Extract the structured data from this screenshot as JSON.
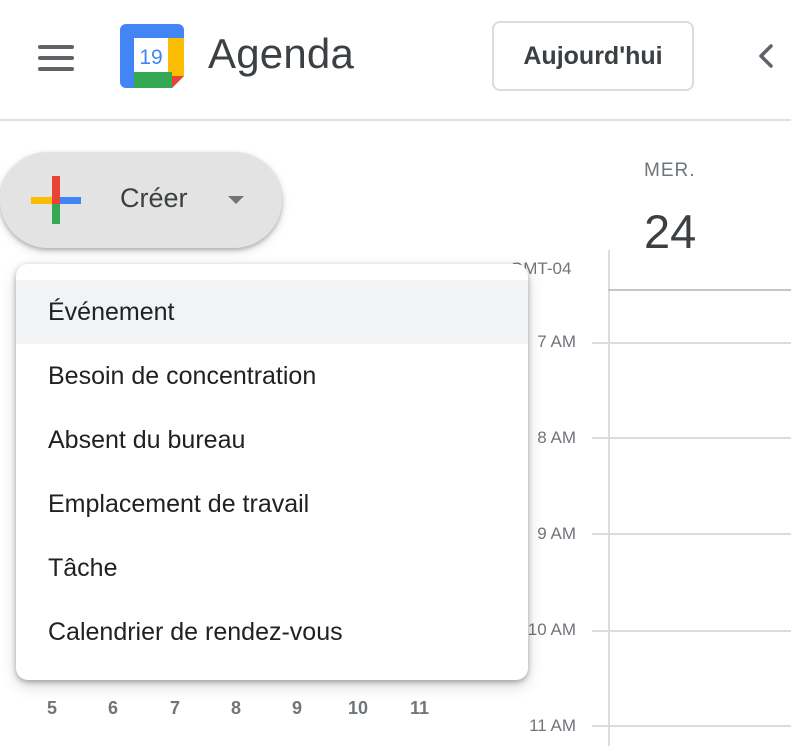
{
  "header": {
    "app_title": "Agenda",
    "logo_date": "19",
    "today_button": "Aujourd'hui",
    "menu_icon": "hamburger-menu-icon",
    "prev_icon": "chevron-left-icon"
  },
  "create": {
    "label": "Créer",
    "icon": "plus-icon",
    "caret_icon": "caret-down-icon"
  },
  "create_menu": {
    "items": [
      {
        "label": "Événement",
        "active": true
      },
      {
        "label": "Besoin de concentration"
      },
      {
        "label": "Absent du bureau"
      },
      {
        "label": "Emplacement de travail"
      },
      {
        "label": "Tâche"
      },
      {
        "label": "Calendrier de rendez-vous"
      }
    ]
  },
  "day_view": {
    "day_name": "MER.",
    "day_number": "24",
    "timezone": "GMT-04",
    "times": [
      "7 AM",
      "8 AM",
      "9 AM",
      "10 AM",
      "11 AM"
    ]
  },
  "mini_calendar": {
    "row_days": [
      "5",
      "6",
      "7",
      "8",
      "9",
      "10",
      "11"
    ]
  },
  "colors": {
    "blue": "#4285f4",
    "red": "#ea4335",
    "yellow": "#fbbc04",
    "green": "#34a853",
    "text": "#3c4043",
    "muted": "#70757a",
    "grid": "#dadce0",
    "highlight": "#f1f3f4"
  }
}
